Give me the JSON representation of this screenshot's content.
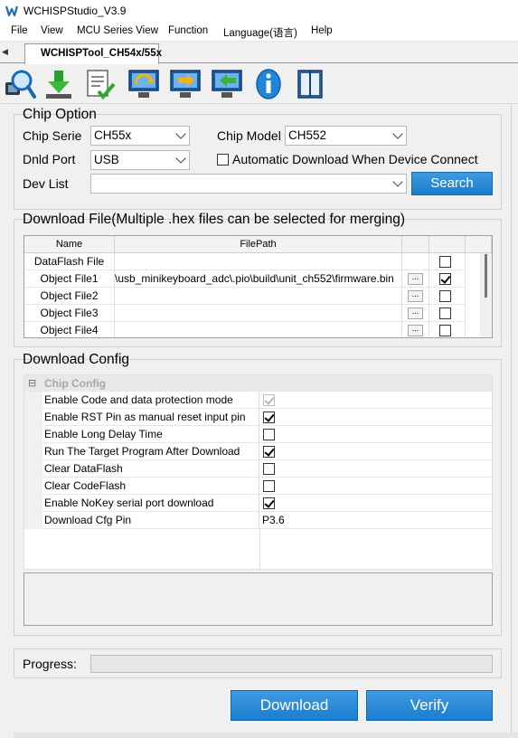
{
  "window": {
    "title": "WCHISPStudio_V3.9"
  },
  "menu": [
    "File",
    "View",
    "MCU Series View",
    "Function",
    "Language(语言)",
    "Help"
  ],
  "tab": {
    "scroll_left": "◀",
    "active_label": "WCHISPTool_CH54x/55x"
  },
  "toolbar": [
    "search-device-icon",
    "download-icon",
    "checklist-icon",
    "refresh-icon",
    "export-icon",
    "import-icon",
    "info-icon",
    "book-icon"
  ],
  "chip_option": {
    "title": "Chip Option",
    "chip_serie_label": "Chip Serie",
    "chip_serie_value": "CH55x",
    "chip_model_label": "Chip Model",
    "chip_model_value": "CH552",
    "dnld_port_label": "Dnld Port",
    "dnld_port_value": "USB",
    "auto_download_label": "Automatic Download When Device Connect",
    "dev_list_label": "Dev List",
    "dev_list_value": "",
    "search_label": "Search"
  },
  "download_file": {
    "title": "Download File(Multiple .hex files can be selected for merging)",
    "columns": [
      "Name",
      "FilePath"
    ],
    "browse_label": "...",
    "rows": [
      {
        "name": "DataFlash File",
        "path": "",
        "has_browse": false,
        "checked": false
      },
      {
        "name": "Object File1",
        "path": "\\usb_minikeyboard_adc\\.pio\\build\\unit_ch552\\firmware.bin",
        "has_browse": true,
        "checked": true
      },
      {
        "name": "Object File2",
        "path": "",
        "has_browse": true,
        "checked": false
      },
      {
        "name": "Object File3",
        "path": "",
        "has_browse": true,
        "checked": false
      },
      {
        "name": "Object File4",
        "path": "",
        "has_browse": true,
        "checked": false
      }
    ]
  },
  "download_config": {
    "title": "Download Config",
    "category": "Chip Config",
    "category_toggle": "⊟",
    "items": [
      {
        "name": "Enable Code and data protection mode",
        "type": "check",
        "checked": true,
        "disabled": true
      },
      {
        "name": "Enable RST Pin as manual reset input pin",
        "type": "check",
        "checked": true
      },
      {
        "name": "Enable Long Delay Time",
        "type": "check",
        "checked": false
      },
      {
        "name": "Run The Target Program After Download",
        "type": "check",
        "checked": true
      },
      {
        "name": "Clear DataFlash",
        "type": "check",
        "checked": false
      },
      {
        "name": "Clear CodeFlash",
        "type": "check",
        "checked": false
      },
      {
        "name": "Enable NoKey serial port download",
        "type": "check",
        "checked": true
      },
      {
        "name": "Download Cfg Pin",
        "type": "text",
        "value": "P3.6"
      }
    ]
  },
  "progress": {
    "label": "Progress:",
    "value": 0
  },
  "actions": {
    "download_label": "Download",
    "verify_label": "Verify"
  },
  "colors": {
    "accent": "#1a7ed0",
    "category_text": "#a6a6a6"
  }
}
